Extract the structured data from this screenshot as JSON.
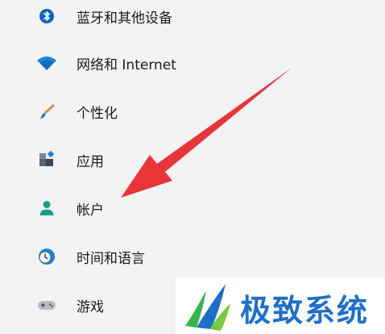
{
  "nav": {
    "items": [
      {
        "label": "蓝牙和其他设备",
        "icon": "bluetooth-icon"
      },
      {
        "label": "网络和 Internet",
        "icon": "wifi-icon"
      },
      {
        "label": "个性化",
        "icon": "paintbrush-icon"
      },
      {
        "label": "应用",
        "icon": "apps-icon"
      },
      {
        "label": "帐户",
        "icon": "account-person-icon"
      },
      {
        "label": "时间和语言",
        "icon": "clock-globe-icon"
      },
      {
        "label": "游戏",
        "icon": "gamepad-icon"
      }
    ]
  },
  "annotation": {
    "arrow_color": "#e8353a",
    "points_to": "帐户"
  },
  "watermark": {
    "text": "极致系统",
    "color": "#1e6fc8"
  },
  "colors": {
    "background": "#f3f3f3",
    "accent_blue": "#0067c0",
    "account_teal": "#1d9c8a"
  }
}
